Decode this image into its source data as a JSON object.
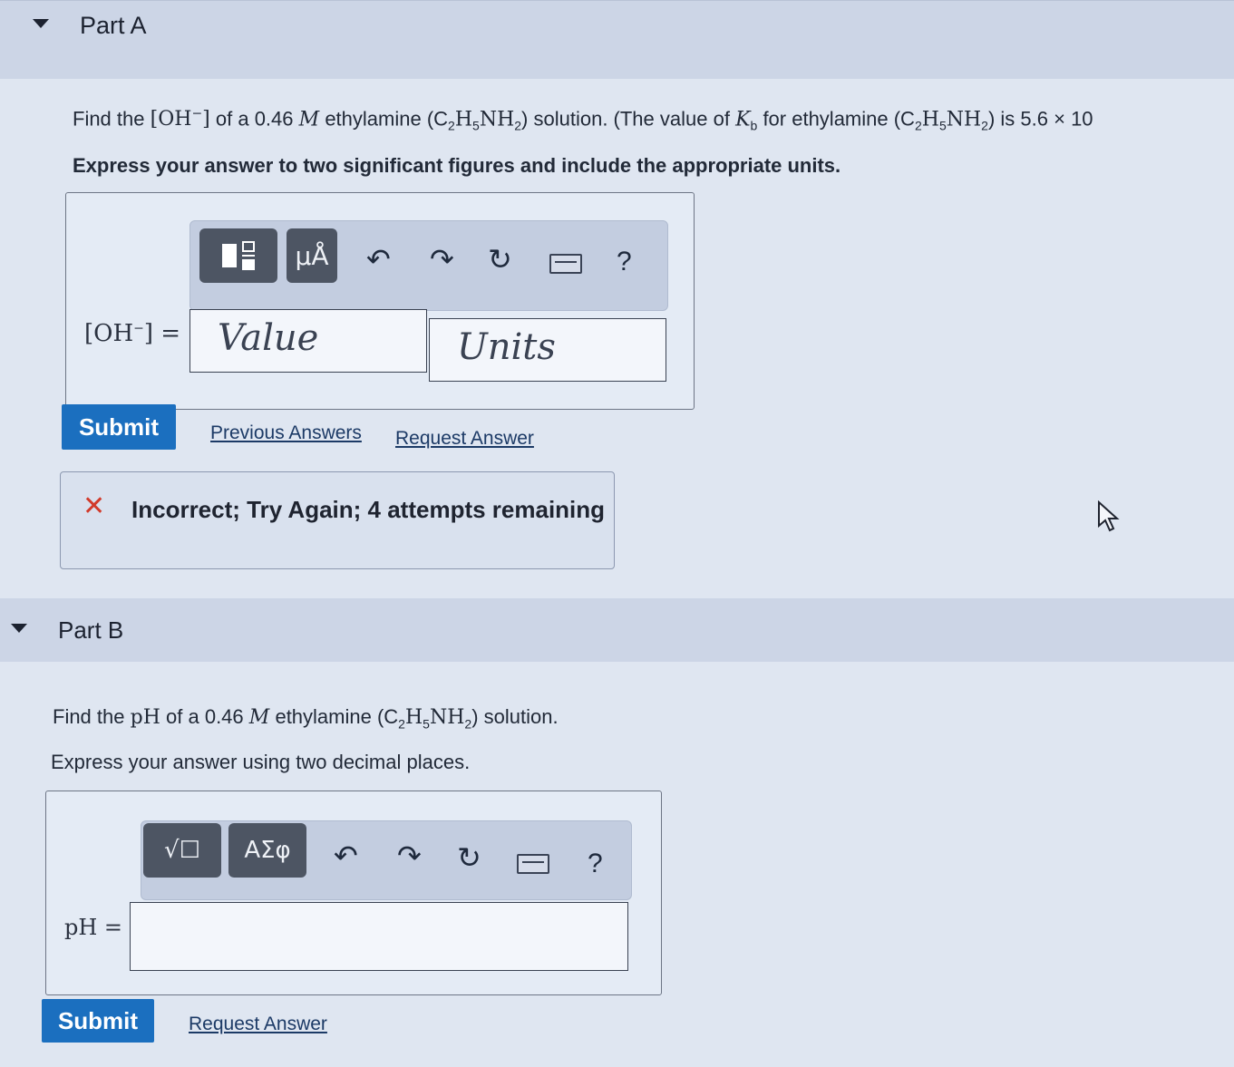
{
  "partA": {
    "title": "Part A",
    "question_prefix": "Find the",
    "question_conc": "[OH",
    "question_conc_sup": "−",
    "question_conc_close": "]",
    "question_of": "of a 0.46",
    "question_M": "M",
    "question_rest": "ethylamine (C",
    "question_tail": "H",
    "question_tail2": "NH",
    "question_tail3": ") solution. (The value of",
    "question_Kb": "K",
    "question_Kb_sub": "b",
    "question_for": "for ethylamine (C",
    "question_end": ") is 5.6 × 10",
    "instruction": "Express your answer to two significant figures and include the appropriate units.",
    "equation_label": "[OH",
    "equation_label_sup": "−",
    "equation_label_close": "] =",
    "value_placeholder": "Value",
    "units_placeholder": "Units",
    "toolbar": {
      "templates_icon": "fraction-template-icon",
      "units_button": "μÅ",
      "undo_icon": "↶",
      "redo_icon": "↷",
      "reset_icon": "↻",
      "keyboard_icon": "keyboard-icon",
      "help": "?"
    },
    "submit_label": "Submit",
    "previous_answers_label": "Previous Answers",
    "request_answer_label": "Request Answer",
    "feedback_mark": "✕",
    "feedback_text": "Incorrect; Try Again; 4 attempts remaining"
  },
  "partB": {
    "title": "Part B",
    "question_prefix": "Find the",
    "question_pH": "pH",
    "question_of": "of a 0.46",
    "question_M": "M",
    "question_rest": "ethylamine (C",
    "question_end": ") solution.",
    "instruction": "Express your answer using two decimal places.",
    "equation_label": "pH =",
    "toolbar": {
      "templates_button": "√☐",
      "greek_button": "ΑΣφ",
      "undo_icon": "↶",
      "redo_icon": "↷",
      "reset_icon": "↻",
      "keyboard_icon": "keyboard-icon",
      "help": "?"
    },
    "submit_label": "Submit",
    "request_answer_label": "Request Answer"
  },
  "sub": {
    "two": "2",
    "five": "5"
  },
  "colors": {
    "submit": "#1b6fbf",
    "feedback_x": "#d23a2a",
    "header_band": "#ccd5e6"
  }
}
